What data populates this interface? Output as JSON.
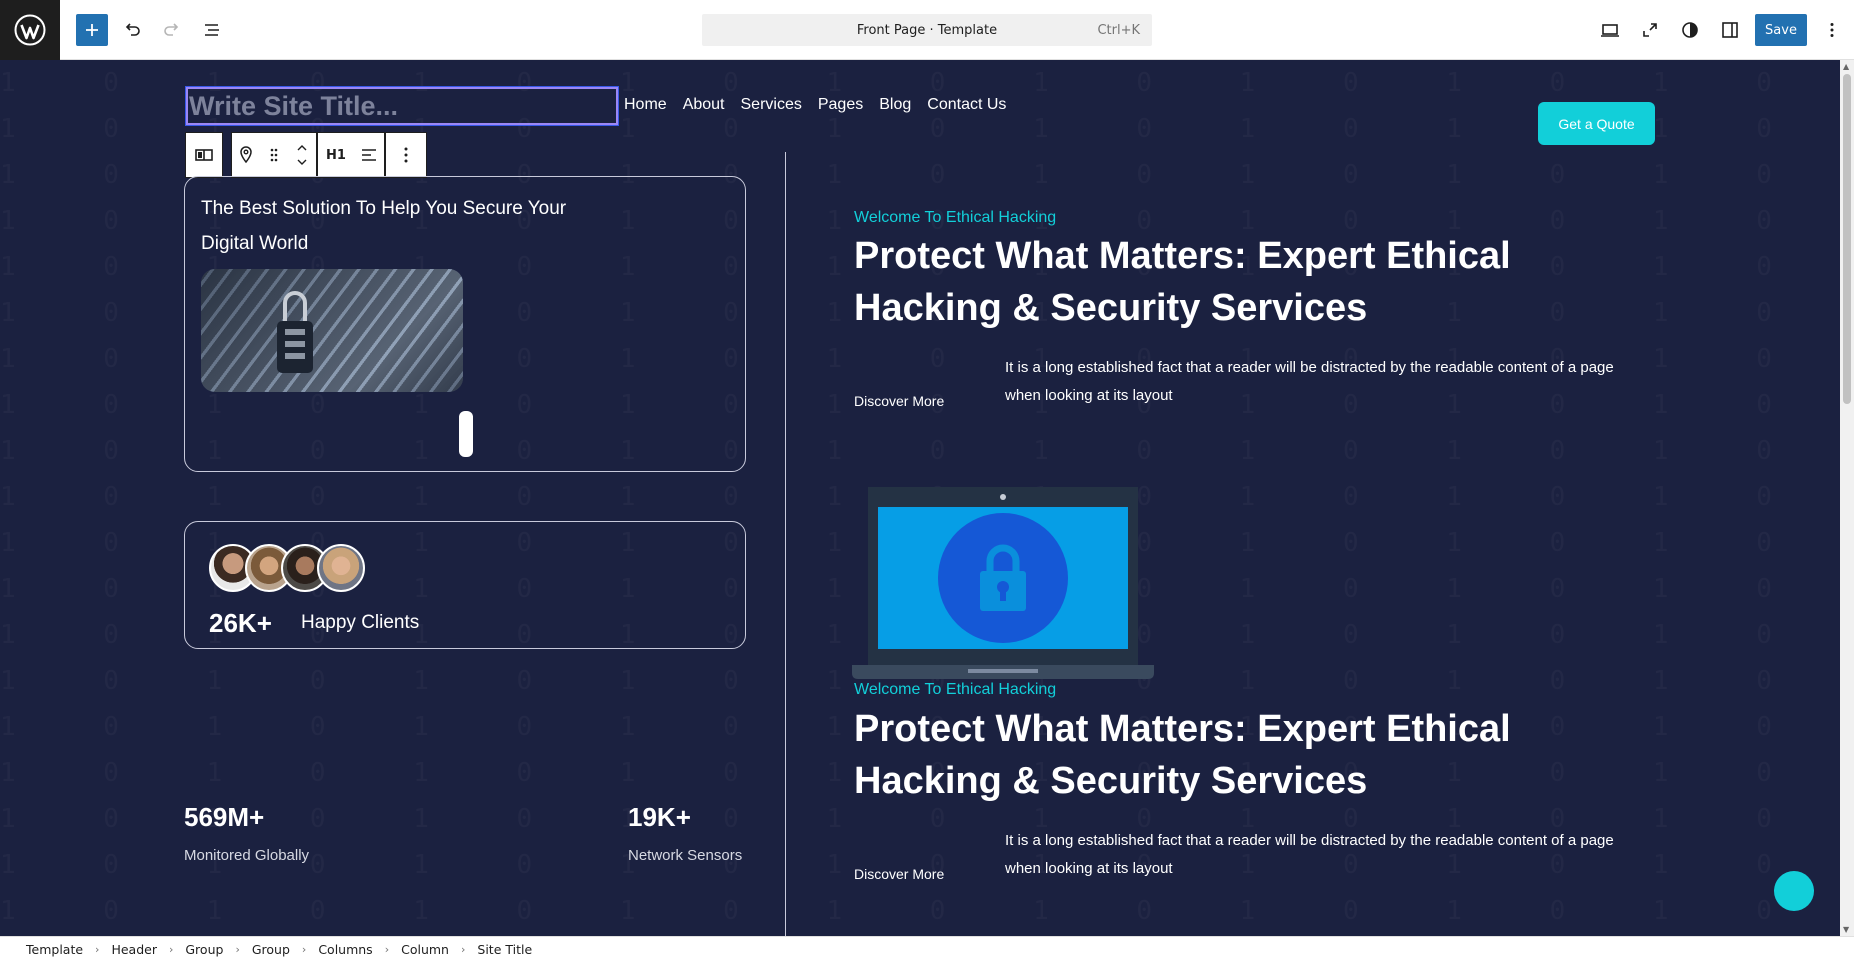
{
  "topbar": {
    "command_label": "Front Page · Template",
    "command_shortcut": "Ctrl+K",
    "save_label": "Save"
  },
  "header": {
    "site_title_placeholder": "Write Site Title...",
    "nav": [
      "Home",
      "About",
      "Services",
      "Pages",
      "Blog",
      "Contact Us"
    ],
    "quote_label": "Get a Quote"
  },
  "block_toolbar": {
    "heading_level": "H1"
  },
  "left": {
    "card_text": "The Best Solution To Help You Secure Your Digital World",
    "clients_value": "26K+",
    "clients_label": "Happy Clients",
    "stat1_value": "569M+",
    "stat1_label": "Monitored Globally",
    "stat2_value": "19K+",
    "stat2_label": "Network Sensors"
  },
  "right": {
    "sections": [
      {
        "eyebrow": "Welcome To Ethical Hacking",
        "heading": "Protect What Matters: Expert Ethical Hacking & Security Services",
        "discover": "Discover More",
        "paragraph": "It is a long established fact that a reader will be distracted by the readable content of a page when looking at its layout"
      },
      {
        "eyebrow": "Welcome To Ethical Hacking",
        "heading": "Protect What Matters: Expert Ethical Hacking & Security Services",
        "discover": "Discover More",
        "paragraph": "It is a long established fact that a reader will be distracted by the readable content of a page when looking at its layout"
      }
    ]
  },
  "breadcrumb": [
    "Template",
    "Header",
    "Group",
    "Group",
    "Columns",
    "Column",
    "Site Title"
  ],
  "colors": {
    "canvas_bg": "#1b2140",
    "accent": "#12cfd9",
    "wp_blue": "#2271b1",
    "selection": "#9b87f5"
  }
}
